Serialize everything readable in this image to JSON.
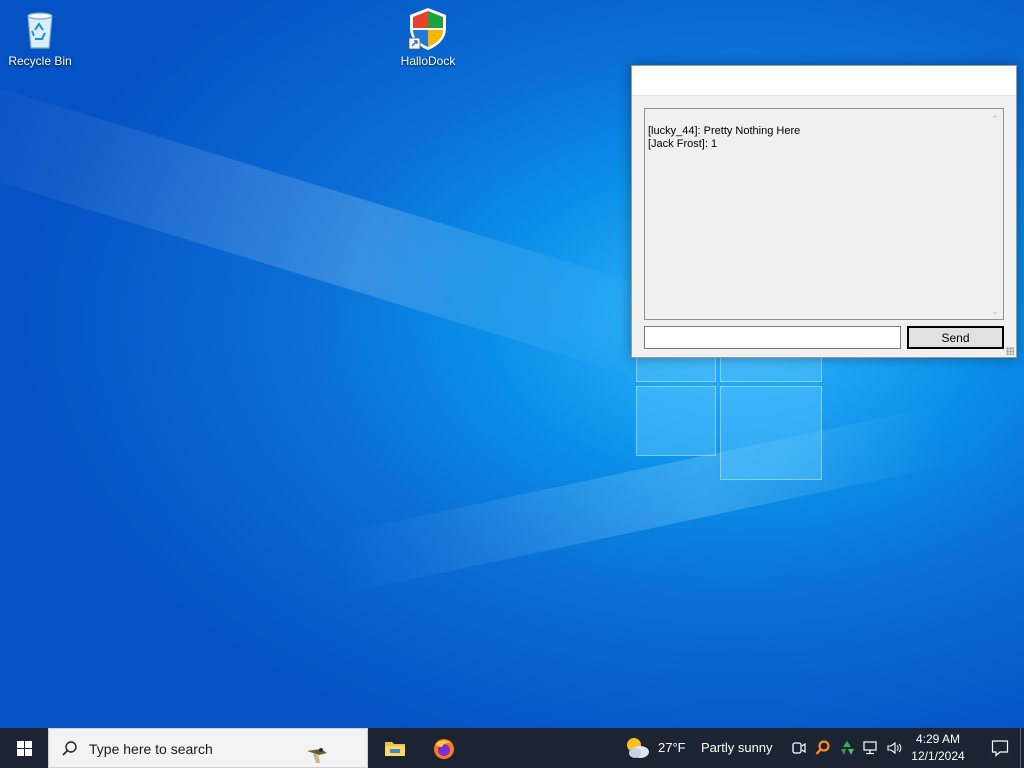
{
  "desktop": {
    "icons": [
      {
        "label": "Recycle Bin",
        "icon": "recycle-bin-icon"
      },
      {
        "label": "HalloDock",
        "icon": "shield-icon"
      }
    ]
  },
  "chat_window": {
    "title": "",
    "messages": [
      "[lucky_44]: Pretty Nothing Here",
      "[Jack Frost]: 1"
    ],
    "input_value": "",
    "send_label": "Send"
  },
  "taskbar": {
    "search_placeholder": "Type here to search",
    "pinned_apps": [
      {
        "name": "File Explorer",
        "icon": "folder-icon"
      },
      {
        "name": "Firefox",
        "icon": "firefox-icon"
      }
    ],
    "weather": {
      "temperature": "27°F",
      "condition": "Partly sunny",
      "icon": "partly-sunny-icon"
    },
    "tray_icons": [
      "meet-now-icon",
      "search-tool-icon",
      "recycle-tray-icon",
      "network-icon",
      "volume-icon"
    ],
    "clock": {
      "time": "4:29 AM",
      "date": "12/1/2024"
    }
  },
  "colors": {
    "wallpaper": "#0a6fd6",
    "taskbar": "#1c2433",
    "window_bg": "#f0f0f0"
  }
}
